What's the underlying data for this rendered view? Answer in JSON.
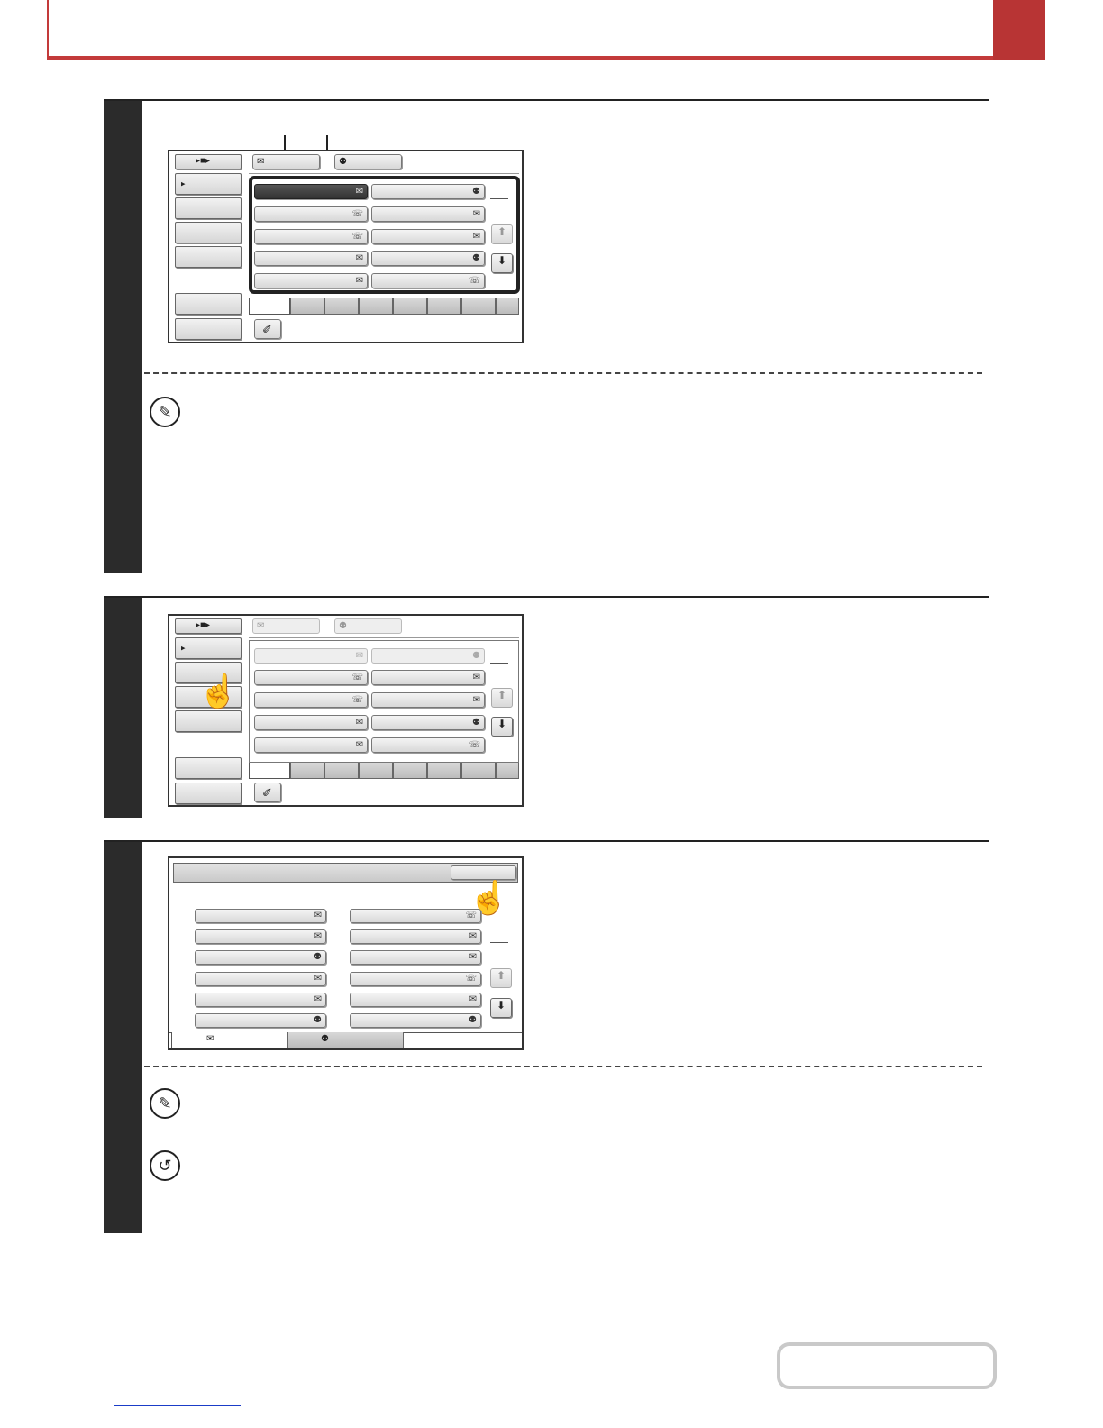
{
  "header": {
    "accent_color": "#c33a3a"
  },
  "icons": {
    "email": "✉",
    "fax": "☏",
    "ifax": "⚉",
    "up": "⬆",
    "down": "⬇",
    "hand": "☝",
    "note": "✎",
    "return": "↺",
    "play_stop": "▸■▸",
    "arrow_right": "▸",
    "edit": "✐"
  },
  "steps": [
    {
      "id": "step-1",
      "screen": "address-book-selected",
      "has_note": true
    },
    {
      "id": "step-2",
      "screen": "address-book-tap",
      "has_note": false
    },
    {
      "id": "step-3",
      "screen": "address-review",
      "has_note": true,
      "has_return_note": true
    }
  ],
  "footer": {
    "contents_button": "",
    "link_text": ""
  }
}
